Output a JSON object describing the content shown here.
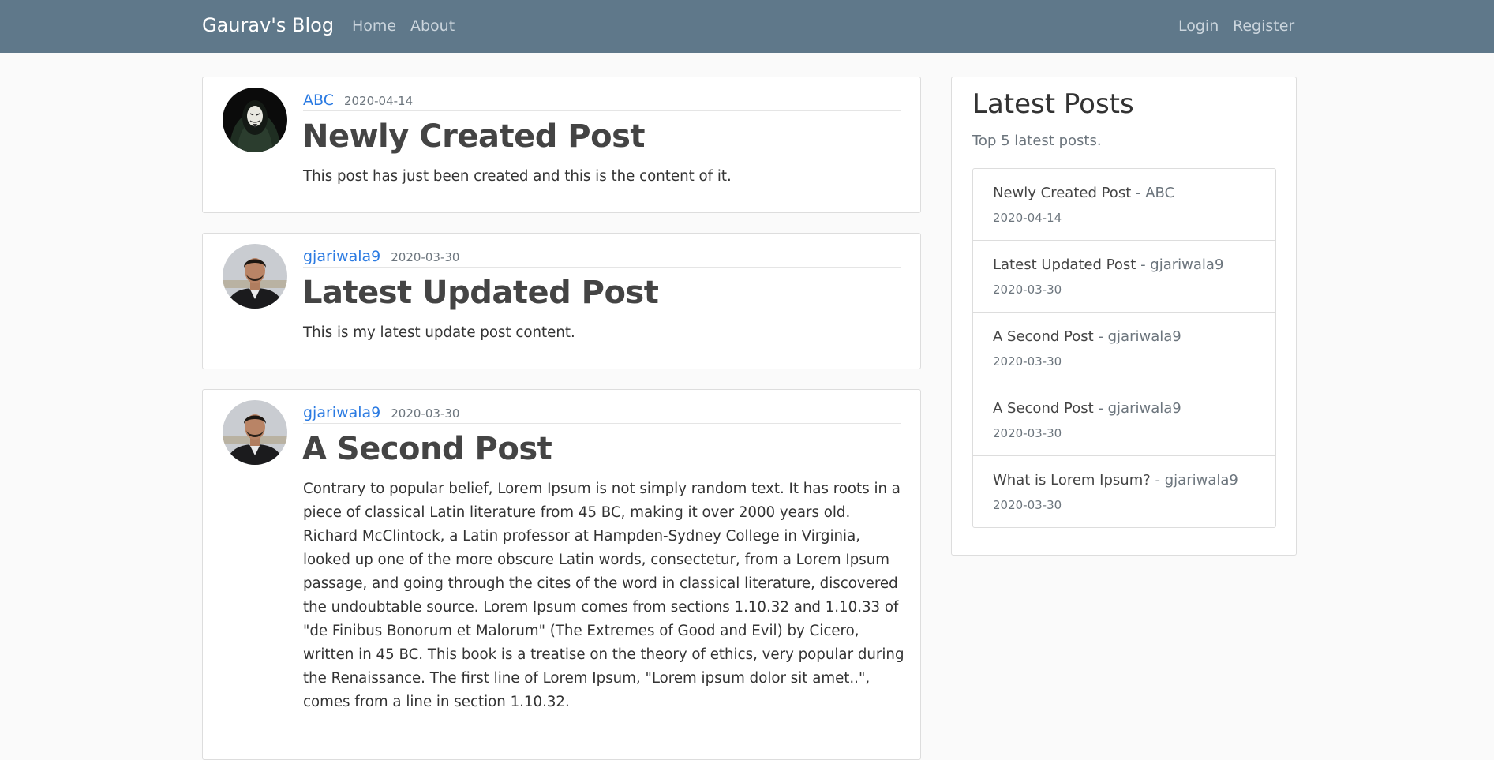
{
  "navbar": {
    "brand": "Gaurav's Blog",
    "links_left": [
      "Home",
      "About"
    ],
    "links_right": [
      "Login",
      "Register"
    ]
  },
  "posts": [
    {
      "author": "ABC",
      "date": "2020-04-14",
      "title": "Newly Created Post",
      "content": "This post has just been created and this is the content of it.",
      "avatar": "anonymous-mask-avatar"
    },
    {
      "author": "gjariwala9",
      "date": "2020-03-30",
      "title": "Latest Updated Post",
      "content": "This is my latest update post content.",
      "avatar": "user-photo-avatar"
    },
    {
      "author": "gjariwala9",
      "date": "2020-03-30",
      "title": "A Second Post",
      "content": "Contrary to popular belief, Lorem Ipsum is not simply random text. It has roots in a piece of classical Latin literature from 45 BC, making it over 2000 years old. Richard McClintock, a Latin professor at Hampden-Sydney College in Virginia, looked up one of the more obscure Latin words, consectetur, from a Lorem Ipsum passage, and going through the cites of the word in classical literature, discovered the undoubtable source. Lorem Ipsum comes from sections 1.10.32 and 1.10.33 of \"de Finibus Bonorum et Malorum\" (The Extremes of Good and Evil) by Cicero, written in 45 BC. This book is a treatise on the theory of ethics, very popular during the Renaissance. The first line of Lorem Ipsum, \"Lorem ipsum dolor sit amet..\", comes from a line in section 1.10.32.",
      "avatar": "user-photo-avatar"
    }
  ],
  "sidebar": {
    "title": "Latest Posts",
    "subtitle": "Top 5 latest posts.",
    "items": [
      {
        "title": "Newly Created Post",
        "author": "- ABC",
        "date": "2020-04-14"
      },
      {
        "title": "Latest Updated Post",
        "author": "- gjariwala9",
        "date": "2020-03-30"
      },
      {
        "title": "A Second Post",
        "author": "- gjariwala9",
        "date": "2020-03-30"
      },
      {
        "title": "A Second Post",
        "author": "- gjariwala9",
        "date": "2020-03-30"
      },
      {
        "title": "What is Lorem Ipsum?",
        "author": "- gjariwala9",
        "date": "2020-03-30"
      }
    ]
  },
  "colors": {
    "navbar": "#5f788a",
    "link": "#2a7ae2",
    "background": "#fafafa"
  }
}
